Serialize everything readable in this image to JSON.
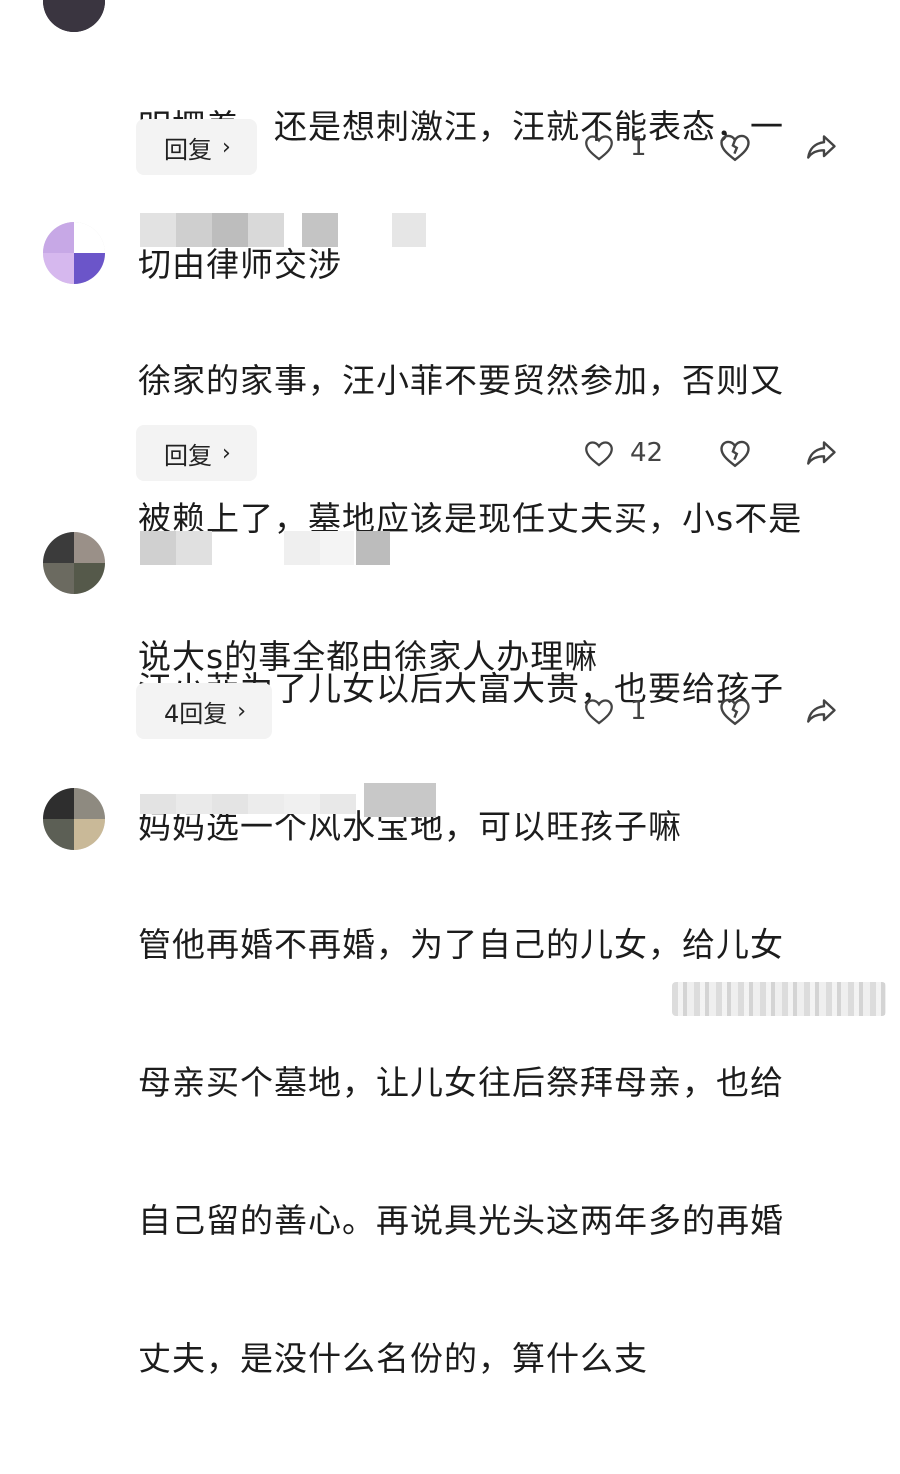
{
  "comments": [
    {
      "text_lines": [
        "明摆着，还是想刺激汪，汪就不能表态，一",
        "切由律师交涉"
      ],
      "reply_label": "回复",
      "likes": "1"
    },
    {
      "text_lines": [
        "徐家的家事，汪小菲不要贸然参加，否则又",
        "被赖上了，墓地应该是现任丈夫买，小s不是",
        "说大s的事全都由徐家人办理嘛"
      ],
      "reply_label": "回复",
      "likes": "42"
    },
    {
      "text_lines": [
        "汪小菲为了儿女以后大富大贵，也要给孩子",
        "妈妈选一个风水宝地，可以旺孩子嘛"
      ],
      "reply_label": "4回复",
      "likes": "1"
    },
    {
      "text_lines": [
        "管他再婚不再婚，为了自己的儿女，给儿女",
        "母亲买个墓地，让儿女往后祭拜母亲，也给",
        "自己留的善心。再说具光头这两年多的再婚",
        "丈夫，是没什么名份的，算什么支"
      ]
    }
  ],
  "icons": {
    "like": "heart-outline-icon",
    "dislike": "broken-heart-icon",
    "share": "share-arrow-icon",
    "reply_chevron": "chevron-right-icon"
  },
  "ui": {
    "chevron": "›"
  }
}
